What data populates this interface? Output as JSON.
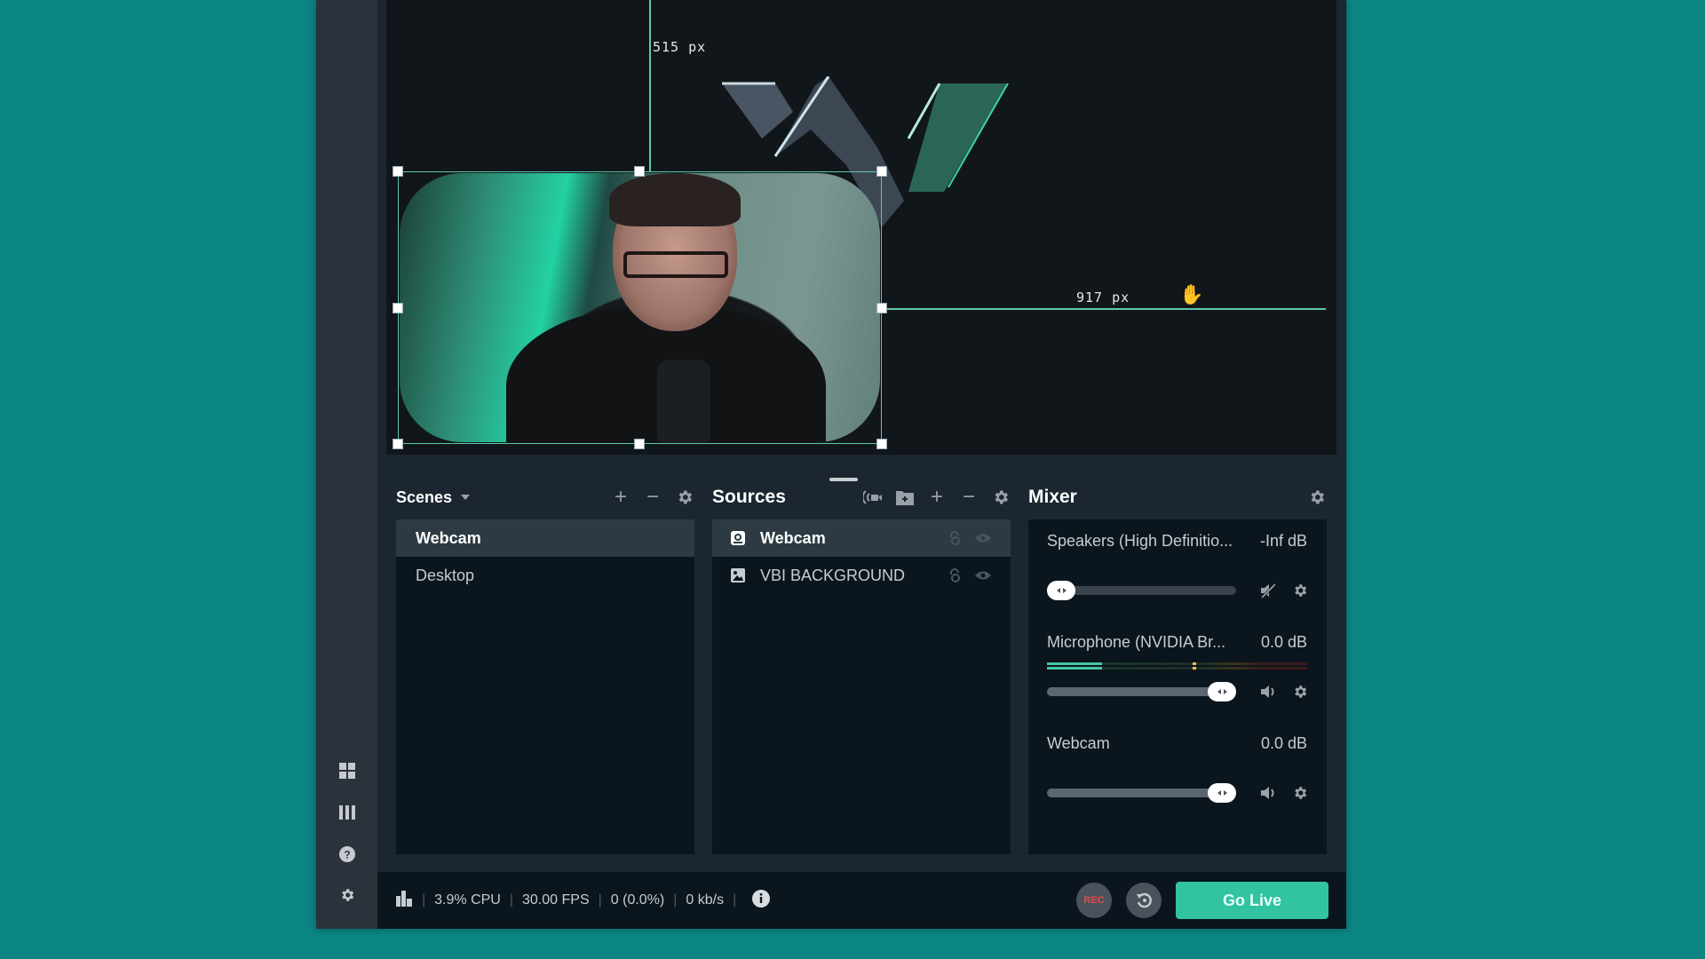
{
  "sidebar": {
    "items": [
      {
        "icon": "layout-grid-icon"
      },
      {
        "icon": "columns-icon"
      },
      {
        "icon": "help-icon"
      },
      {
        "icon": "settings-icon"
      }
    ]
  },
  "preview": {
    "guide_top_label": "515 px",
    "guide_right_label": "917 px",
    "selected_source": "Webcam"
  },
  "scenes": {
    "title": "Scenes",
    "items": [
      {
        "label": "Webcam",
        "active": true
      },
      {
        "label": "Desktop",
        "active": false
      }
    ]
  },
  "sources": {
    "title": "Sources",
    "items": [
      {
        "label": "Webcam",
        "icon": "webcam-icon",
        "active": true
      },
      {
        "label": "VBI BACKGROUND",
        "icon": "image-icon",
        "active": false
      }
    ]
  },
  "mixer": {
    "title": "Mixer",
    "channels": [
      {
        "name": "Speakers (High Definitio...",
        "db": "-Inf dB",
        "volume_pct": 0,
        "muted": true
      },
      {
        "name": "Microphone (NVIDIA Br...",
        "db": "0.0 dB",
        "volume_pct": 100,
        "muted": false,
        "level_pct": 21,
        "peak_pct": 56
      },
      {
        "name": "Webcam",
        "db": "0.0 dB",
        "volume_pct": 100,
        "muted": false
      }
    ]
  },
  "footer": {
    "cpu": "3.9% CPU",
    "fps": "30.00 FPS",
    "dropped": "0 (0.0%)",
    "bitrate": "0 kb/s",
    "rec_label": "REC",
    "go_live_label": "Go Live"
  },
  "colors": {
    "accent": "#31c3a2",
    "background": "#0b8582",
    "rec": "#e34b4b"
  }
}
